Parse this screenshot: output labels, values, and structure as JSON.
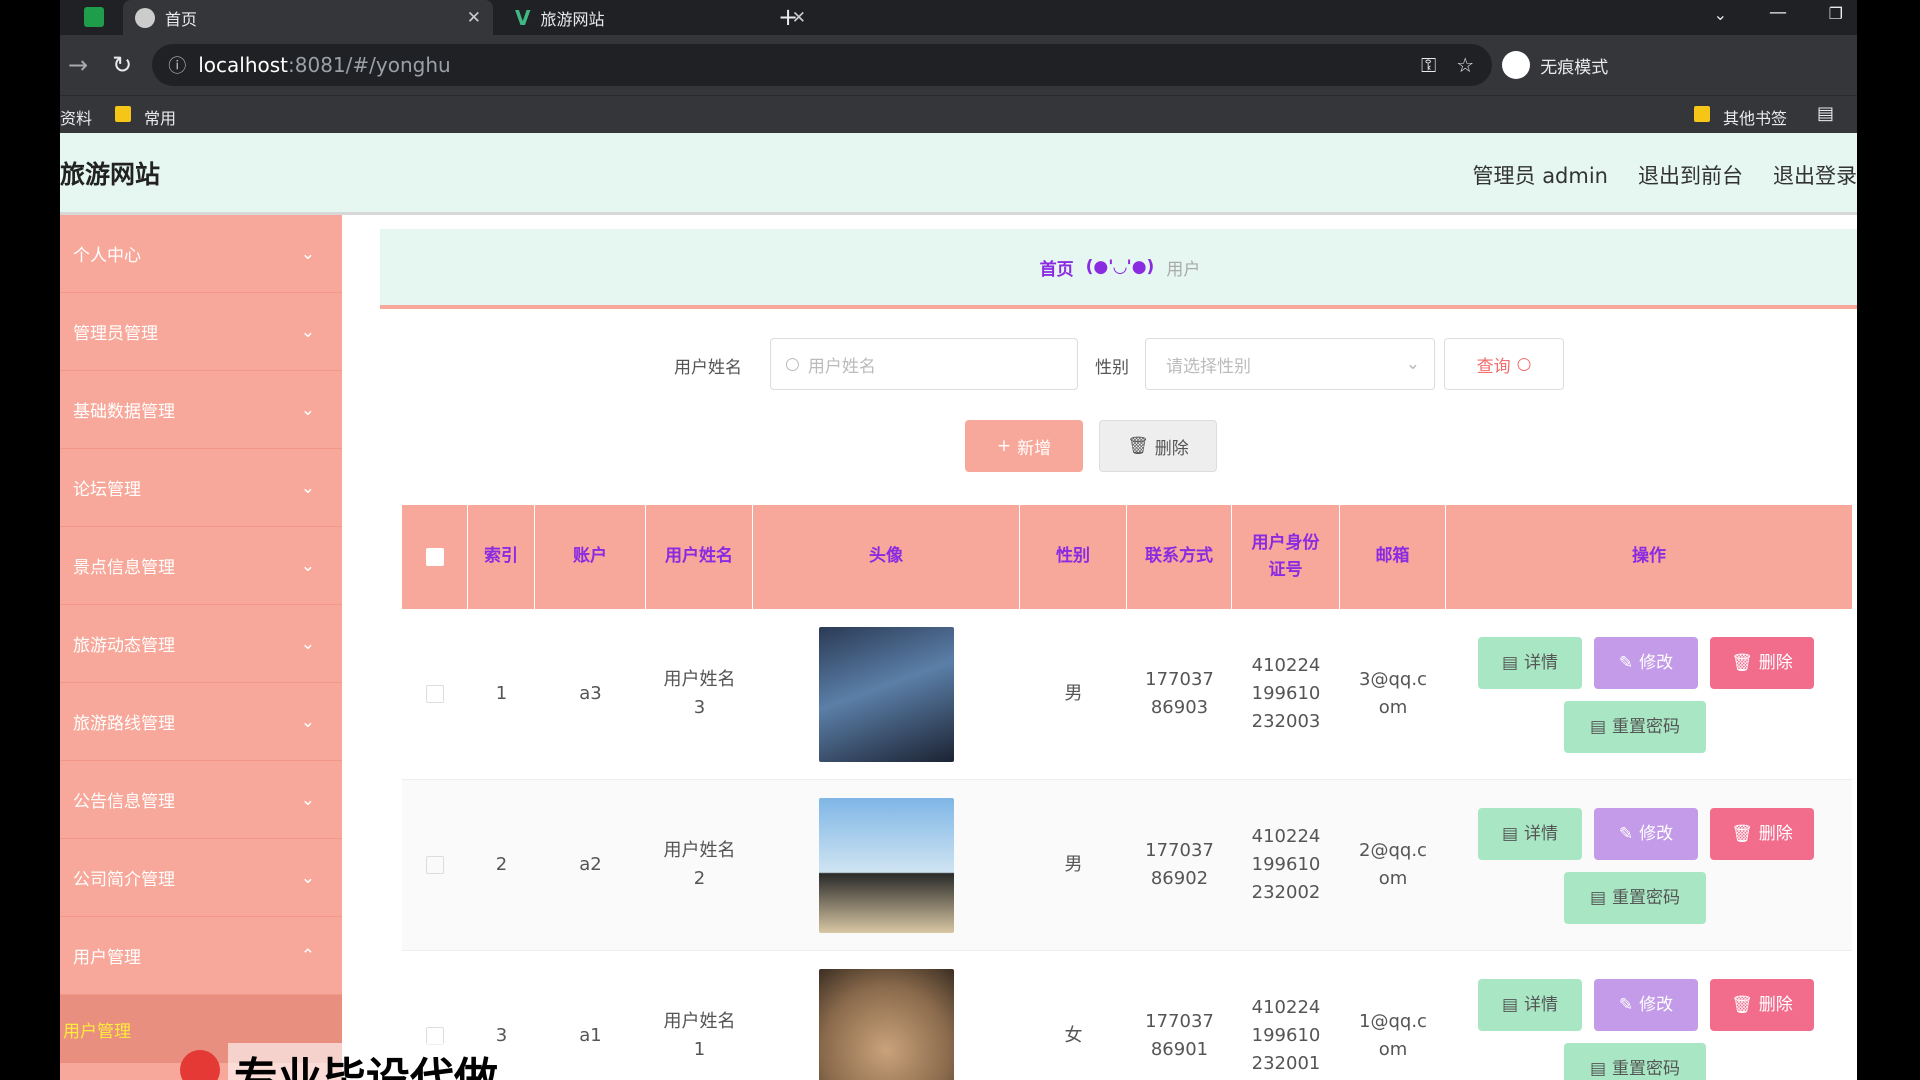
{
  "browser": {
    "tabs": [
      {
        "label": "首页"
      },
      {
        "label": "旅游网站"
      }
    ],
    "url_host": "localhost",
    "url_rest": ":8081/#/yonghu",
    "incognito_label": "无痕模式",
    "bookmarks": {
      "left1": "资料",
      "left2": "常用",
      "right1": "其他书签"
    }
  },
  "app": {
    "title": "旅游网站",
    "header_links": {
      "admin": "管理员 admin",
      "front": "退出到前台",
      "logout": "退出登录"
    }
  },
  "sidebar": {
    "items": [
      {
        "label": "个人中心",
        "expanded": false
      },
      {
        "label": "管理员管理",
        "expanded": false
      },
      {
        "label": "基础数据管理",
        "expanded": false
      },
      {
        "label": "论坛管理",
        "expanded": false
      },
      {
        "label": "景点信息管理",
        "expanded": false
      },
      {
        "label": "旅游动态管理",
        "expanded": false
      },
      {
        "label": "旅游路线管理",
        "expanded": false
      },
      {
        "label": "公告信息管理",
        "expanded": false
      },
      {
        "label": "公司简介管理",
        "expanded": false
      },
      {
        "label": "用户管理",
        "expanded": true
      }
    ],
    "active_sub": "用户管理"
  },
  "breadcrumb": {
    "home": "首页",
    "emoticon": "(●'◡'●)",
    "current": "用户"
  },
  "filters": {
    "name_label": "用户姓名",
    "name_placeholder": "用户姓名",
    "gender_label": "性别",
    "gender_placeholder": "请选择性别",
    "query_label": "查询"
  },
  "actions": {
    "add_label": "新增",
    "delete_label": "删除"
  },
  "table": {
    "headers": {
      "index": "索引",
      "account": "账户",
      "name": "用户姓名",
      "avatar": "头像",
      "gender": "性别",
      "phone": "联系方式",
      "idcard": "用户身份证号",
      "email": "邮箱",
      "ops": "操作"
    },
    "rows": [
      {
        "index": "1",
        "account": "a3",
        "name": "用户姓名3",
        "gender": "男",
        "phone": "17703786903",
        "idcard": "410224199610232003",
        "email": "3@qq.com"
      },
      {
        "index": "2",
        "account": "a2",
        "name": "用户姓名2",
        "gender": "男",
        "phone": "17703786902",
        "idcard": "410224199610232002",
        "email": "2@qq.com"
      },
      {
        "index": "3",
        "account": "a1",
        "name": "用户姓名1",
        "gender": "女",
        "phone": "17703786901",
        "idcard": "410224199610232001",
        "email": "1@qq.com"
      }
    ],
    "row_buttons": {
      "detail": "详情",
      "edit": "修改",
      "delete": "删除",
      "reset": "重置密码"
    }
  },
  "overlay_text": "专业毕设代做",
  "colors": {
    "sidebar": "#f8a89a",
    "header": "#e6f6f0",
    "detail": "#a8e6c4",
    "edit": "#c39be8",
    "delete": "#f26d8c",
    "accent_text": "#8a2be2"
  }
}
